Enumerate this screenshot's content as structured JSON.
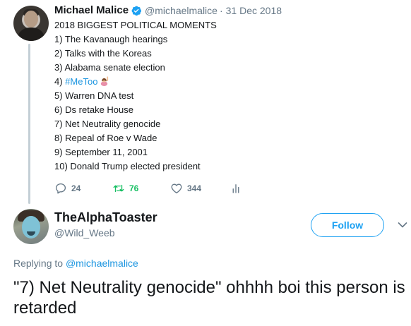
{
  "quoted_tweet": {
    "author_name": "Michael Malice",
    "handle": "@michaelmalice",
    "date_separator": "·",
    "date": "31 Dec 2018",
    "title_line": "2018 BIGGEST POLITICAL MOMENTS",
    "items": [
      "1) The Kavanaugh hearings",
      "2) Talks with the Koreas",
      "3) Alabama senate election",
      "5) Warren DNA test",
      "6) Ds retake House",
      "7) Net Neutrality genocide",
      "8) Repeal of Roe v Wade",
      "9) September 11, 2001",
      "10) Donald Trump elected president"
    ],
    "item4_prefix": "4) ",
    "item4_hashtag": "#MeToo",
    "item4_emoji": "woman-raising-hand-emoji",
    "actions": {
      "replies": "24",
      "retweets": "76",
      "likes": "344"
    }
  },
  "reply_tweet": {
    "author_name": "TheAlphaToaster",
    "handle": "@Wild_Weeb",
    "follow_label": "Follow",
    "replying_prefix": "Replying to",
    "replying_mention": "@michaelmalice",
    "text": "\"7) Net Neutrality genocide\" ohhhh boi this person is retarded"
  },
  "colors": {
    "accent": "#1da1f2",
    "link": "#1b95e0",
    "secondary_text": "#657786",
    "retweet_green": "#17bf63",
    "thread_line": "#c4cfd6"
  },
  "icons": [
    "verified-badge-icon",
    "reply-icon",
    "retweet-icon",
    "like-icon",
    "analytics-icon",
    "chevron-down-icon"
  ]
}
